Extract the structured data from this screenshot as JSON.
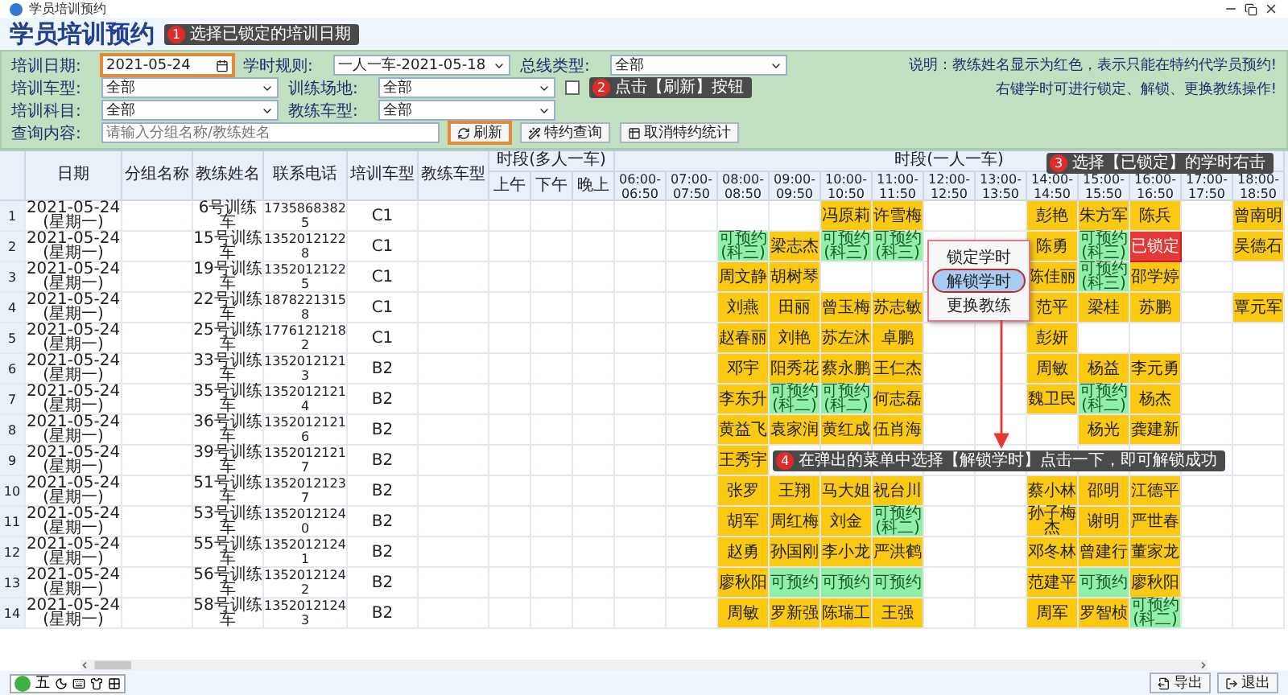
{
  "window": {
    "title": "学员培训预约"
  },
  "page_title": "学员培训预约",
  "callouts": [
    {
      "number": "1",
      "text": "选择已锁定的培训日期"
    },
    {
      "number": "2",
      "text": "点击【刷新】按钮"
    },
    {
      "number": "3",
      "text": "选择【已锁定】的学时右击"
    },
    {
      "number": "4",
      "text": "在弹出的菜单中选择【解锁学时】点击一下，即可解锁成功"
    }
  ],
  "filters": [
    [
      {
        "kind": "date",
        "label": "培训日期:",
        "value": "2021-05-24",
        "highlighted": true
      },
      {
        "kind": "select",
        "label": "学时规则:",
        "value": "一人一车-2021-05-18"
      },
      {
        "kind": "select",
        "label": "总线类型:",
        "value": "全部"
      }
    ],
    [
      {
        "kind": "select",
        "label": "培训车型:",
        "value": "全部"
      },
      {
        "kind": "select",
        "label": "训练场地:",
        "value": "全部"
      },
      {
        "kind": "checkbox",
        "checked": false
      }
    ],
    [
      {
        "kind": "select",
        "label": "培训科目:",
        "value": "全部"
      },
      {
        "kind": "select",
        "label": "教练车型:",
        "value": "全部"
      }
    ],
    [
      {
        "kind": "search",
        "label": "查询内容:",
        "placeholder": "请输入分组名称/教练姓名"
      }
    ]
  ],
  "buttons": [
    {
      "label": "刷新",
      "highlighted": true
    },
    {
      "label": "特约查询",
      "highlighted": false
    },
    {
      "label": "取消特约统计",
      "highlighted": false
    }
  ],
  "notes": [
    "说明：教练姓名显示为红色，表示只能在特约代学员预约!",
    "右键学时可进行锁定、解锁、更换教练操作!"
  ],
  "table": {
    "columns": [
      "日期",
      "分组名称",
      "教练姓名",
      "联系电话",
      "培训车型",
      "教练车型"
    ],
    "multi_header": "时段(多人一车)",
    "multi_columns": [
      "上午",
      "下午",
      "晚上"
    ],
    "single_header": "时段(一人一车)",
    "slots": [
      "06:00-06:50",
      "07:00-07:50",
      "08:00-08:50",
      "09:00-09:50",
      "10:00-10:50",
      "11:00-11:50",
      "12:00-12:50",
      "13:00-13:50",
      "14:00-14:50",
      "15:00-15:50",
      "16:00-16:50",
      "17:00-17:50",
      "18:00-18:50"
    ],
    "rows": [
      {
        "index": "1",
        "date": "2021-05-24(星期一)",
        "coach": "6号训练车",
        "phone": "17358683825",
        "car_type": "C1",
        "cells": [
          {
            "kind": "empty"
          },
          {
            "kind": "empty"
          },
          {
            "kind": "empty"
          },
          {
            "kind": "empty"
          },
          {
            "kind": "booked",
            "name": "冯原莉"
          },
          {
            "kind": "booked",
            "name": "许雪梅"
          },
          {
            "kind": "empty"
          },
          {
            "kind": "empty"
          },
          {
            "kind": "booked",
            "name": "彭艳"
          },
          {
            "kind": "booked",
            "name": "朱方军"
          },
          {
            "kind": "booked",
            "name": "陈兵"
          },
          {
            "kind": "empty"
          },
          {
            "kind": "booked",
            "name": "曾南明"
          }
        ]
      },
      {
        "index": "2",
        "date": "2021-05-24(星期一)",
        "coach": "15号训练车",
        "phone": "13520121228",
        "car_type": "C1",
        "cells": [
          {
            "kind": "empty"
          },
          {
            "kind": "empty"
          },
          {
            "kind": "open",
            "name": "可预约(科三)"
          },
          {
            "kind": "booked",
            "name": "梁志杰"
          },
          {
            "kind": "open",
            "name": "可预约(科三)"
          },
          {
            "kind": "open",
            "name": "可预约(科三)"
          },
          {
            "kind": "empty"
          },
          {
            "kind": "empty"
          },
          {
            "kind": "booked",
            "name": "陈勇"
          },
          {
            "kind": "open",
            "name": "可预约(科三)"
          },
          {
            "kind": "locked",
            "name": "已锁定"
          },
          {
            "kind": "empty"
          },
          {
            "kind": "booked",
            "name": "吴德石"
          }
        ]
      },
      {
        "index": "3",
        "date": "2021-05-24(星期一)",
        "coach": "19号训练车",
        "phone": "13520121225",
        "car_type": "C1",
        "cells": [
          {
            "kind": "empty"
          },
          {
            "kind": "empty"
          },
          {
            "kind": "booked",
            "name": "周文静"
          },
          {
            "kind": "booked",
            "name": "胡树琴"
          },
          {
            "kind": "empty"
          },
          {
            "kind": "empty"
          },
          {
            "kind": "empty"
          },
          {
            "kind": "empty"
          },
          {
            "kind": "booked",
            "name": "陈佳丽"
          },
          {
            "kind": "open",
            "name": "可预约(科三)"
          },
          {
            "kind": "booked",
            "name": "邵学婷"
          },
          {
            "kind": "empty"
          },
          {
            "kind": "empty"
          }
        ]
      },
      {
        "index": "4",
        "date": "2021-05-24(星期一)",
        "coach": "22号训练车",
        "phone": "18782213158",
        "car_type": "C1",
        "cells": [
          {
            "kind": "empty"
          },
          {
            "kind": "empty"
          },
          {
            "kind": "booked",
            "name": "刘燕"
          },
          {
            "kind": "booked",
            "name": "田丽"
          },
          {
            "kind": "booked",
            "name": "曾玉梅"
          },
          {
            "kind": "booked",
            "name": "苏志敏"
          },
          {
            "kind": "empty"
          },
          {
            "kind": "empty"
          },
          {
            "kind": "booked",
            "name": "范平"
          },
          {
            "kind": "booked",
            "name": "梁桂"
          },
          {
            "kind": "booked",
            "name": "苏鹏"
          },
          {
            "kind": "empty"
          },
          {
            "kind": "booked",
            "name": "覃元军"
          }
        ]
      },
      {
        "index": "5",
        "date": "2021-05-24(星期一)",
        "coach": "25号训练车",
        "phone": "17761212182",
        "car_type": "C1",
        "cells": [
          {
            "kind": "empty"
          },
          {
            "kind": "empty"
          },
          {
            "kind": "booked",
            "name": "赵春丽"
          },
          {
            "kind": "booked",
            "name": "刘艳"
          },
          {
            "kind": "booked",
            "name": "苏左沐"
          },
          {
            "kind": "booked",
            "name": "卓鹏"
          },
          {
            "kind": "empty"
          },
          {
            "kind": "empty"
          },
          {
            "kind": "booked",
            "name": "彭妍"
          },
          {
            "kind": "empty"
          },
          {
            "kind": "empty"
          },
          {
            "kind": "empty"
          },
          {
            "kind": "empty"
          }
        ]
      },
      {
        "index": "6",
        "date": "2021-05-24(星期一)",
        "coach": "33号训练车",
        "phone": "13520121213",
        "car_type": "B2",
        "cells": [
          {
            "kind": "empty"
          },
          {
            "kind": "empty"
          },
          {
            "kind": "booked",
            "name": "邓宇"
          },
          {
            "kind": "booked",
            "name": "阳秀花"
          },
          {
            "kind": "booked",
            "name": "蔡永鹏"
          },
          {
            "kind": "booked",
            "name": "王仁杰"
          },
          {
            "kind": "empty"
          },
          {
            "kind": "empty"
          },
          {
            "kind": "booked",
            "name": "周敏"
          },
          {
            "kind": "booked",
            "name": "杨益"
          },
          {
            "kind": "booked",
            "name": "李元勇"
          },
          {
            "kind": "empty"
          },
          {
            "kind": "empty"
          }
        ]
      },
      {
        "index": "7",
        "date": "2021-05-24(星期一)",
        "coach": "35号训练车",
        "phone": "13520121214",
        "car_type": "B2",
        "cells": [
          {
            "kind": "empty"
          },
          {
            "kind": "empty"
          },
          {
            "kind": "booked",
            "name": "李东升"
          },
          {
            "kind": "open",
            "name": "可预约(科二)"
          },
          {
            "kind": "open",
            "name": "可预约(科二)"
          },
          {
            "kind": "booked",
            "name": "何志磊"
          },
          {
            "kind": "empty"
          },
          {
            "kind": "empty"
          },
          {
            "kind": "booked",
            "name": "魏卫民"
          },
          {
            "kind": "open",
            "name": "可预约(科二)"
          },
          {
            "kind": "booked",
            "name": "杨杰"
          },
          {
            "kind": "empty"
          },
          {
            "kind": "empty"
          }
        ]
      },
      {
        "index": "8",
        "date": "2021-05-24(星期一)",
        "coach": "36号训练车",
        "phone": "13520121216",
        "car_type": "B2",
        "cells": [
          {
            "kind": "empty"
          },
          {
            "kind": "empty"
          },
          {
            "kind": "booked",
            "name": "黄益飞"
          },
          {
            "kind": "booked",
            "name": "袁家润"
          },
          {
            "kind": "booked",
            "name": "黄红成"
          },
          {
            "kind": "booked",
            "name": "伍肖海"
          },
          {
            "kind": "empty"
          },
          {
            "kind": "empty"
          },
          {
            "kind": "empty"
          },
          {
            "kind": "booked",
            "name": "杨光"
          },
          {
            "kind": "booked",
            "name": "龚建新"
          },
          {
            "kind": "empty"
          },
          {
            "kind": "empty"
          }
        ]
      },
      {
        "index": "9",
        "date": "2021-05-24(星期一)",
        "coach": "39号训练车",
        "phone": "13520121217",
        "car_type": "B2",
        "cells": [
          {
            "kind": "empty"
          },
          {
            "kind": "empty"
          },
          {
            "kind": "booked",
            "name": "王秀宇"
          },
          {
            "kind": "empty"
          },
          {
            "kind": "empty"
          },
          {
            "kind": "empty"
          },
          {
            "kind": "empty"
          },
          {
            "kind": "empty"
          },
          {
            "kind": "empty"
          },
          {
            "kind": "empty"
          },
          {
            "kind": "empty"
          },
          {
            "kind": "empty"
          },
          {
            "kind": "empty"
          }
        ]
      },
      {
        "index": "10",
        "date": "2021-05-24(星期一)",
        "coach": "51号训练车",
        "phone": "13520121237",
        "car_type": "B2",
        "cells": [
          {
            "kind": "empty"
          },
          {
            "kind": "empty"
          },
          {
            "kind": "booked",
            "name": "张罗"
          },
          {
            "kind": "booked",
            "name": "王翔"
          },
          {
            "kind": "booked",
            "name": "马大姐"
          },
          {
            "kind": "booked",
            "name": "祝台川"
          },
          {
            "kind": "empty"
          },
          {
            "kind": "empty"
          },
          {
            "kind": "booked",
            "name": "蔡小林"
          },
          {
            "kind": "booked",
            "name": "邵明"
          },
          {
            "kind": "booked",
            "name": "江德平"
          },
          {
            "kind": "empty"
          },
          {
            "kind": "empty"
          }
        ]
      },
      {
        "index": "11",
        "date": "2021-05-24(星期一)",
        "coach": "53号训练车",
        "phone": "13520121240",
        "car_type": "B2",
        "cells": [
          {
            "kind": "empty"
          },
          {
            "kind": "empty"
          },
          {
            "kind": "booked",
            "name": "胡军"
          },
          {
            "kind": "booked",
            "name": "周红梅"
          },
          {
            "kind": "booked",
            "name": "刘金"
          },
          {
            "kind": "open",
            "name": "可预约(科二)"
          },
          {
            "kind": "empty"
          },
          {
            "kind": "empty"
          },
          {
            "kind": "booked",
            "name": "孙子梅杰"
          },
          {
            "kind": "booked",
            "name": "谢明"
          },
          {
            "kind": "booked",
            "name": "严世春"
          },
          {
            "kind": "empty"
          },
          {
            "kind": "empty"
          }
        ]
      },
      {
        "index": "12",
        "date": "2021-05-24(星期一)",
        "coach": "55号训练车",
        "phone": "13520121241",
        "car_type": "B2",
        "cells": [
          {
            "kind": "empty"
          },
          {
            "kind": "empty"
          },
          {
            "kind": "booked",
            "name": "赵勇"
          },
          {
            "kind": "booked",
            "name": "孙国刚"
          },
          {
            "kind": "booked",
            "name": "李小龙"
          },
          {
            "kind": "booked",
            "name": "严洪鹤"
          },
          {
            "kind": "empty"
          },
          {
            "kind": "empty"
          },
          {
            "kind": "booked",
            "name": "邓冬林"
          },
          {
            "kind": "booked",
            "name": "曾建行"
          },
          {
            "kind": "booked",
            "name": "董家龙"
          },
          {
            "kind": "empty"
          },
          {
            "kind": "empty"
          }
        ]
      },
      {
        "index": "13",
        "date": "2021-05-24(星期一)",
        "coach": "56号训练车",
        "phone": "13520121242",
        "car_type": "B2",
        "cells": [
          {
            "kind": "empty"
          },
          {
            "kind": "empty"
          },
          {
            "kind": "booked",
            "name": "廖秋阳"
          },
          {
            "kind": "open",
            "name": "可预约"
          },
          {
            "kind": "open",
            "name": "可预约"
          },
          {
            "kind": "open",
            "name": "可预约"
          },
          {
            "kind": "empty"
          },
          {
            "kind": "empty"
          },
          {
            "kind": "booked",
            "name": "范建平"
          },
          {
            "kind": "open",
            "name": "可预约"
          },
          {
            "kind": "booked",
            "name": "廖秋阳"
          },
          {
            "kind": "empty"
          },
          {
            "kind": "empty"
          }
        ]
      },
      {
        "index": "14",
        "date": "2021-05-24(星期一)",
        "coach": "58号训练车",
        "phone": "13520121243",
        "car_type": "B2",
        "cells": [
          {
            "kind": "empty"
          },
          {
            "kind": "empty"
          },
          {
            "kind": "booked",
            "name": "周敏"
          },
          {
            "kind": "booked",
            "name": "罗新强"
          },
          {
            "kind": "booked",
            "name": "陈瑞工"
          },
          {
            "kind": "booked",
            "name": "王强"
          },
          {
            "kind": "empty"
          },
          {
            "kind": "empty"
          },
          {
            "kind": "booked",
            "name": "周军"
          },
          {
            "kind": "booked",
            "name": "罗智桢"
          },
          {
            "kind": "open",
            "name": "可预约(科二)"
          },
          {
            "kind": "empty"
          },
          {
            "kind": "empty"
          }
        ]
      }
    ]
  },
  "context_menu": {
    "items": [
      {
        "label": "锁定学时",
        "selected": false
      },
      {
        "label": "解锁学时",
        "selected": true
      },
      {
        "label": "更换教练",
        "selected": false
      }
    ]
  },
  "bottom": {
    "ime_mode": "五",
    "buttons": [
      "导出",
      "退出"
    ]
  }
}
